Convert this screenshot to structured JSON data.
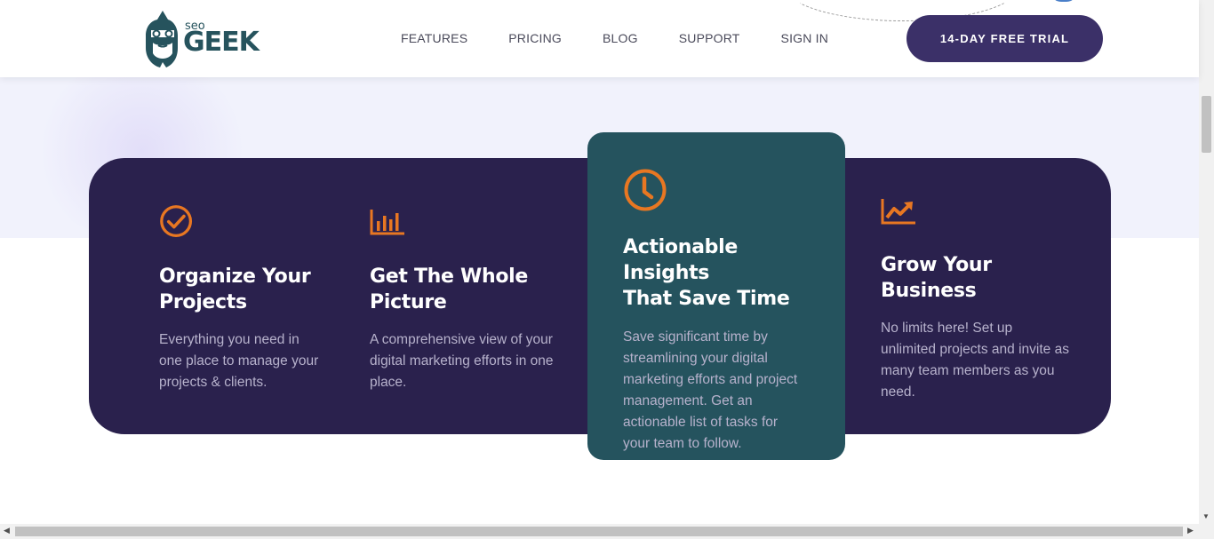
{
  "logo": {
    "small": "seo",
    "big": "GEEK"
  },
  "nav": [
    "FEATURES",
    "PRICING",
    "BLOG",
    "SUPPORT",
    "SIGN IN"
  ],
  "cta_label": "14-DAY FREE TRIAL",
  "colors": {
    "primary": "#3b3068",
    "panel": "#2a214d",
    "highlight": "#25535e",
    "accent": "#e87722",
    "band": "#f1f2fc"
  },
  "features": [
    {
      "icon": "check-circle-icon",
      "title_1": "Organize Your",
      "title_2": "Projects",
      "desc": [
        "Everything you need in",
        "one place to manage your",
        "projects & clients."
      ]
    },
    {
      "icon": "bar-chart-icon",
      "title_1": "Get The Whole",
      "title_2": "Picture",
      "desc": [
        "A comprehensive view of your",
        "digital marketing efforts in one",
        "place."
      ]
    },
    {
      "icon": "clock-icon",
      "title_1": "Actionable Insights",
      "title_2": "That Save Time",
      "desc": [
        "Save significant time by",
        "streamlining your digital",
        "marketing efforts and project",
        "management. Get an",
        "actionable list of tasks for",
        "your team to follow."
      ]
    },
    {
      "icon": "trend-up-icon",
      "title_1": "Grow Your",
      "title_2": "Business",
      "desc": [
        "No limits here! Set up",
        "unlimited projects and invite as",
        "many team members as you",
        "need."
      ]
    }
  ]
}
